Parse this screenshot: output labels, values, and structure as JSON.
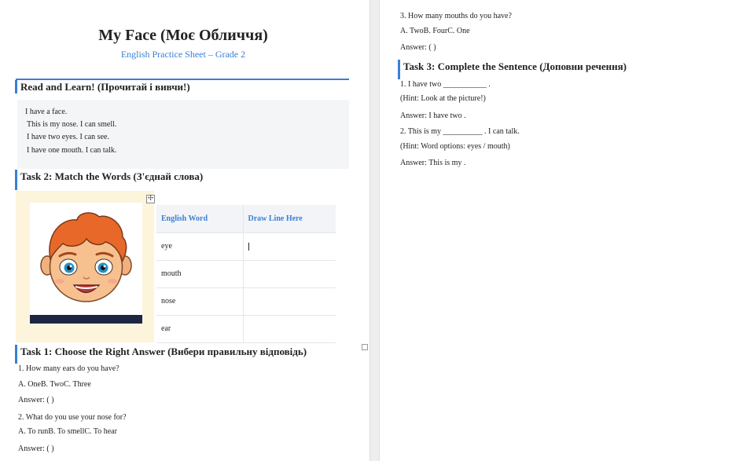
{
  "document": {
    "title": "My Face (Моє Обличчя)",
    "subtitle": "English Practice Sheet – Grade 2"
  },
  "read_section": {
    "heading": "Read and Learn! (Прочитай і вивчи!)",
    "lines": [
      "I have a face.",
      "This is my nose. I can smell.",
      "I have two eyes. I can see.",
      "I have one mouth. I can talk."
    ]
  },
  "task2": {
    "heading": "Task 2: Match the Words (З'єднай слова)",
    "image_alt": "cartoon boy face",
    "table_handle_glyph": "✢",
    "columns": [
      "English Word",
      "Draw Line Here"
    ],
    "rows": [
      "eye",
      "mouth",
      "nose",
      "ear"
    ]
  },
  "task1": {
    "heading": "Task 1: Choose the Right Answer (Вибери правильну відповідь)",
    "questions": [
      {
        "q": "1. How many ears do you have?",
        "options": "A. OneB. TwoC. Three",
        "answer": "Answer: ( )"
      },
      {
        "q": "2. What do you use your nose for?",
        "options": "A. To runB. To smellC. To hear",
        "answer": "Answer: ( )"
      },
      {
        "q": "3. How many mouths do you have?",
        "options": "A. TwoB. FourC. One",
        "answer": "Answer: ( )"
      }
    ]
  },
  "task3": {
    "heading": "Task 3: Complete the Sentence (Доповни речення)",
    "items": [
      {
        "sentence": "1. I have two ___________ .",
        "hint": "(Hint: Look at the picture!)",
        "answer": "Answer: I have two ."
      },
      {
        "sentence": "2. This is my __________ . I can talk.",
        "hint": "(Hint: Word options: eyes / mouth)",
        "answer": "Answer: This is my ."
      }
    ]
  },
  "colors": {
    "accent": "#3a7fd5",
    "hair": "#e8682a",
    "skin": "#f7c08f",
    "eye": "#2a8fc0"
  }
}
